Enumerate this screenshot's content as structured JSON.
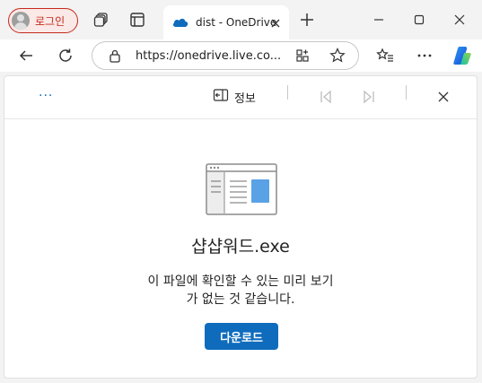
{
  "browser": {
    "profile_label": "로그인",
    "tab_title": "dist - OneDrive",
    "url": "https://onedrive.live.co..."
  },
  "viewer": {
    "more_label": "···",
    "info_label": "정보",
    "file_name": "샵샵워드.exe",
    "message_line1": "이 파일에 확인할 수 있는 미리 보기",
    "message_line2": "가 없는 것 같습니다.",
    "download_label": "다운로드"
  },
  "colors": {
    "accent": "#0f6cbd",
    "profile_border": "#c42b1c"
  },
  "icons": [
    "user-avatar-icon",
    "collections-icon",
    "tab-actions-icon",
    "onedrive-cloud-icon",
    "close-icon",
    "new-tab-icon",
    "minimize-icon",
    "maximize-icon",
    "window-close-icon",
    "back-icon",
    "refresh-icon",
    "lock-icon",
    "apps-icon",
    "favorite-star-icon",
    "favorites-list-icon",
    "more-icon",
    "copilot-icon",
    "info-panel-icon",
    "previous-icon",
    "next-icon",
    "file-preview-icon"
  ]
}
